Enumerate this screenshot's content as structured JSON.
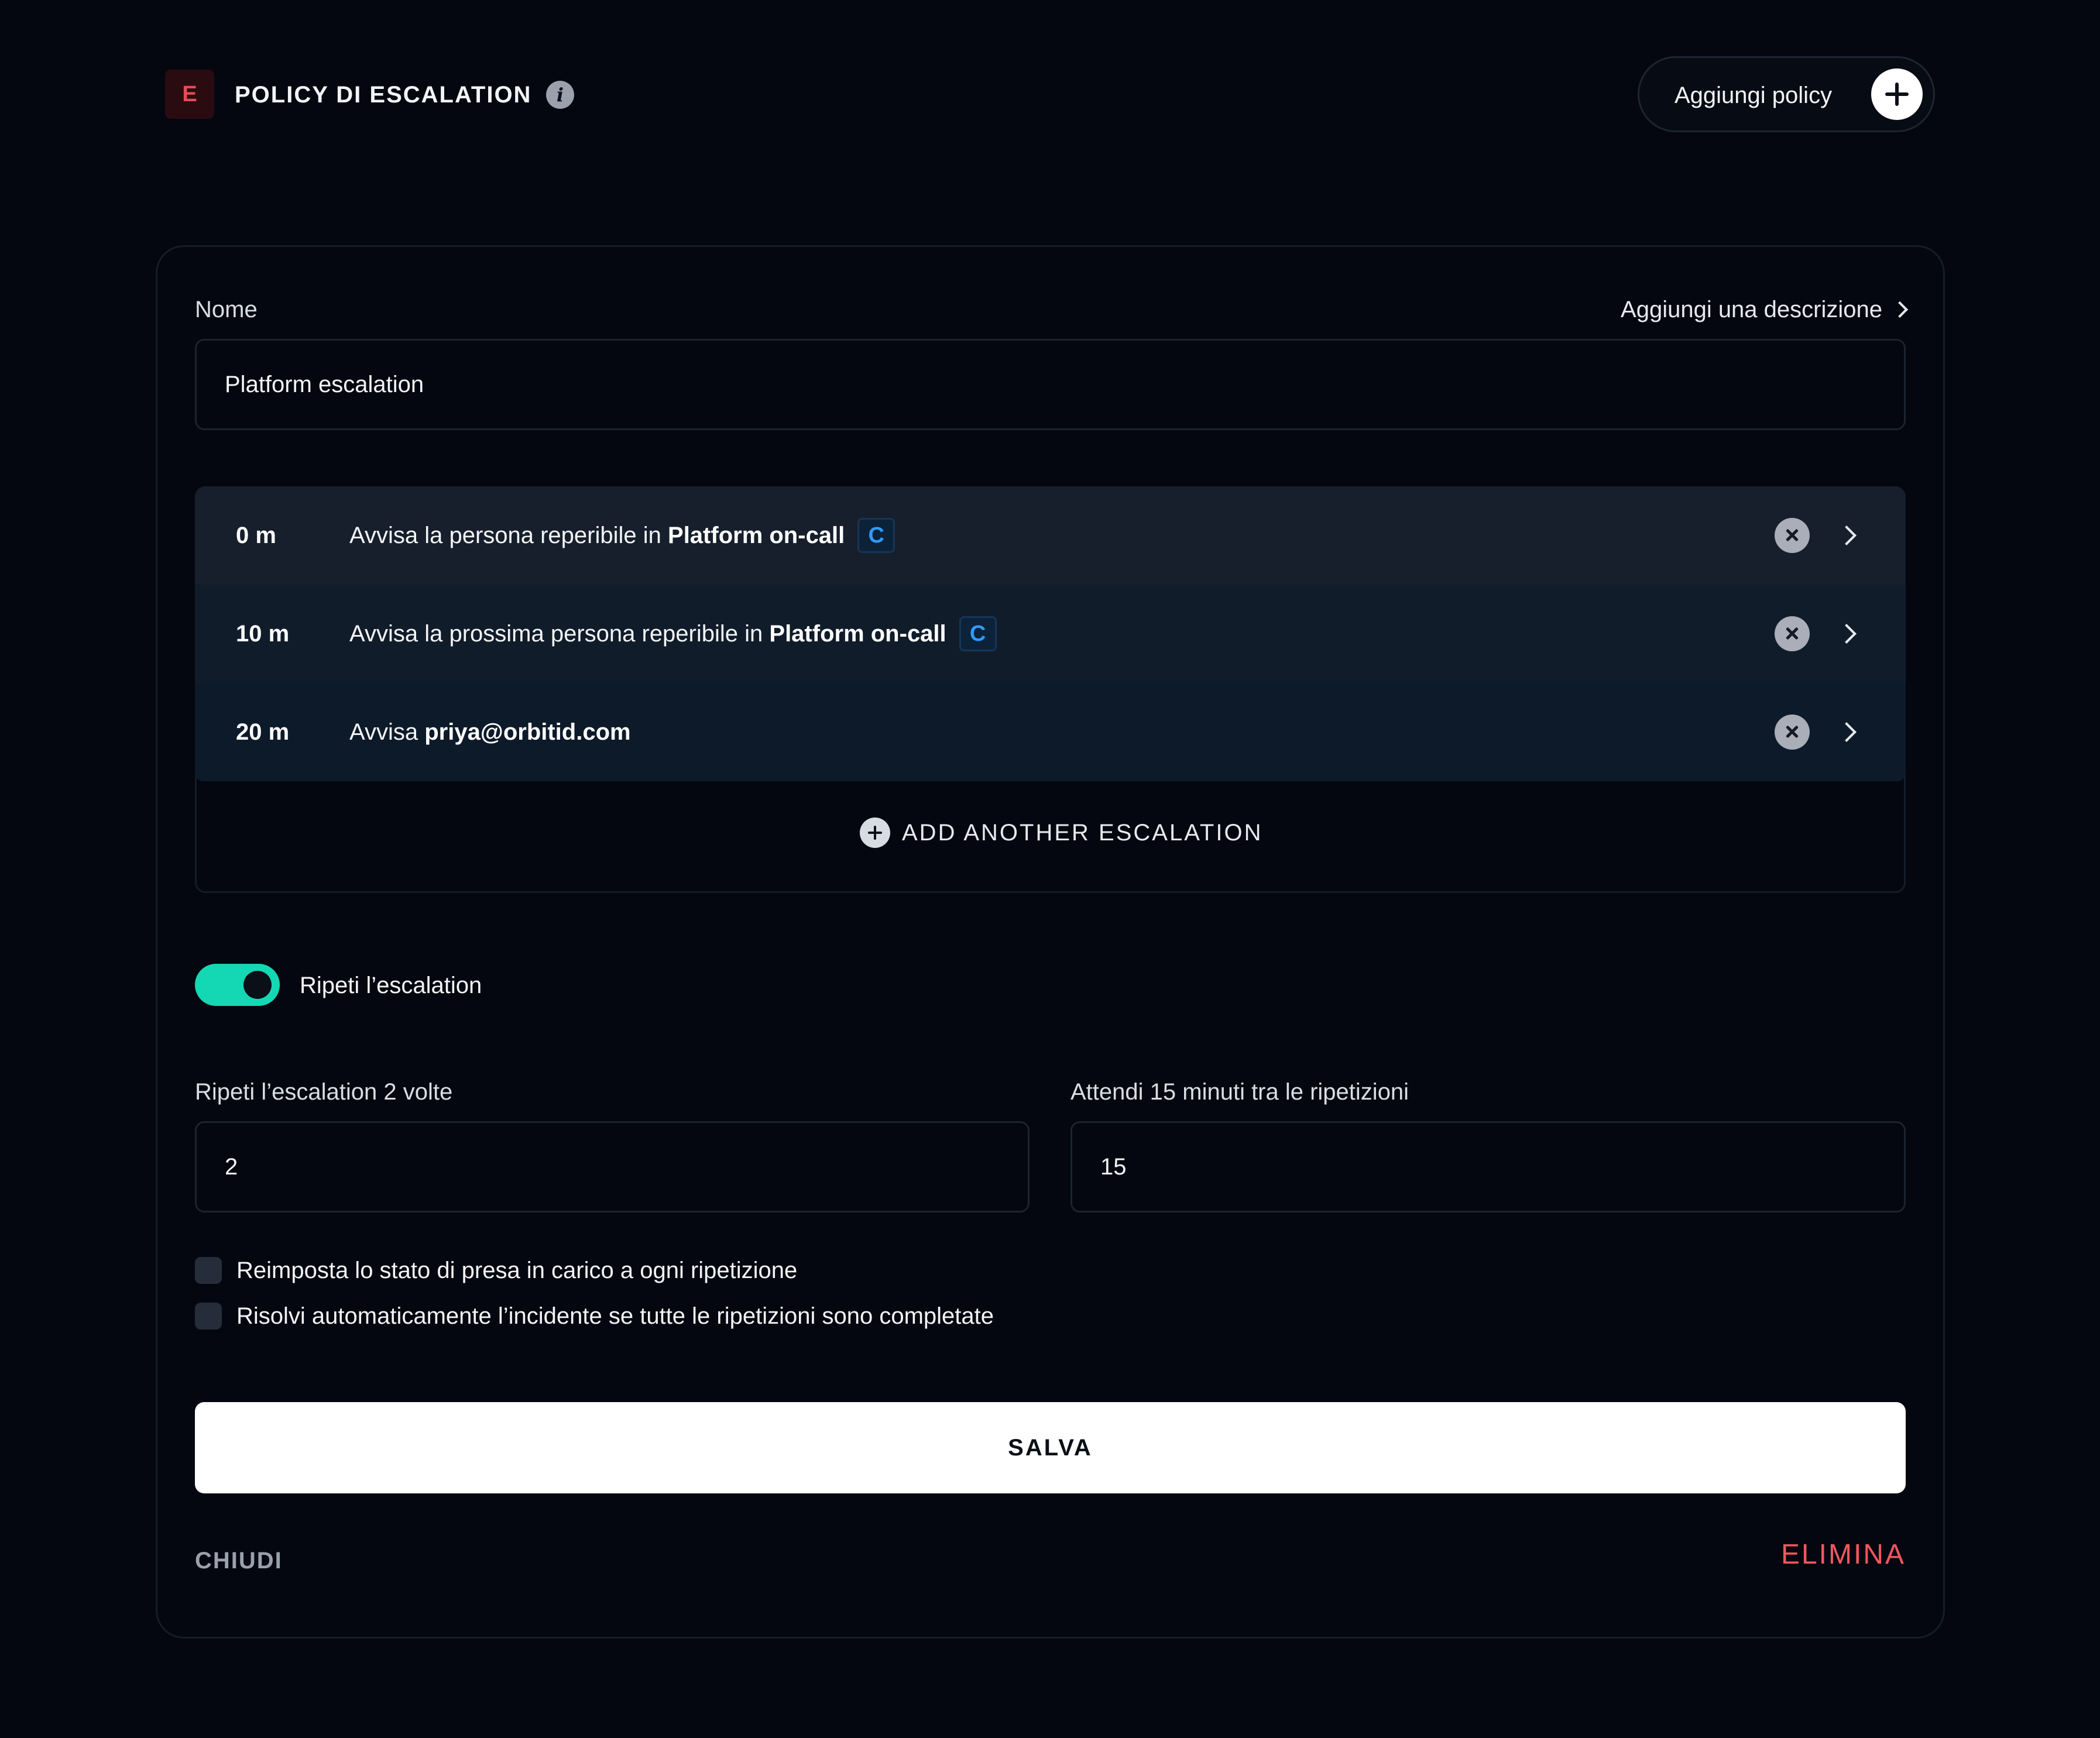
{
  "header": {
    "logo_letter": "E",
    "title": "POLICY DI ESCALATION",
    "info_icon": "info-icon",
    "add_policy_label": "Aggiungi policy",
    "add_policy_icon": "plus-icon"
  },
  "form": {
    "name_label": "Nome",
    "add_description_label": "Aggiungi una descrizione",
    "name_value": "Platform escalation",
    "escalations": [
      {
        "time": "0 m",
        "prefix": "Avvisa la persona reperibile in ",
        "target": "Platform on-call",
        "chip": "C"
      },
      {
        "time": "10 m",
        "prefix": "Avvisa la prossima persona reperibile in ",
        "target": "Platform on-call",
        "chip": "C"
      },
      {
        "time": "20 m",
        "prefix": "Avvisa ",
        "target": "priya@orbitid.com",
        "chip": ""
      }
    ],
    "add_escalation_label": "ADD ANOTHER ESCALATION",
    "repeat_toggle_label": "Ripeti l’escalation",
    "repeat_toggle_on": true,
    "repeat_times_label": "Ripeti l’escalation 2 volte",
    "repeat_times_value": "2",
    "wait_label": "Attendi 15 minuti tra le ripetizioni",
    "wait_value": "15",
    "checkboxes": [
      {
        "label": "Reimposta lo stato di presa in carico a ogni ripetizione",
        "checked": false
      },
      {
        "label": "Risolvi automaticamente l’incidente se tutte le ripetizioni sono completate",
        "checked": false
      }
    ],
    "save_label": "SALVA",
    "close_label": "CHIUDI",
    "delete_label": "ELIMINA"
  },
  "colors": {
    "background": "#04070f",
    "accent_toggle": "#14d8b4",
    "danger": "#f0575e",
    "chip_text": "#2f9bff",
    "logo_text": "#e54b57"
  }
}
